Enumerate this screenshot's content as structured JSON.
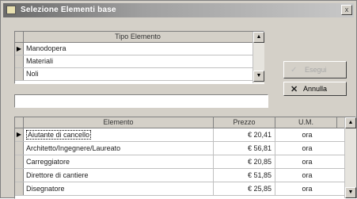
{
  "window": {
    "title": "Selezione Elementi base",
    "close_glyph": "x"
  },
  "types_table": {
    "header": "Tipo Elemento",
    "rows": [
      {
        "label": "Manodopera",
        "current": true
      },
      {
        "label": "Materiali",
        "current": false
      },
      {
        "label": "Noli",
        "current": false
      }
    ],
    "current_marker": "▶",
    "scroll_up": "▲",
    "scroll_down": "▼"
  },
  "buttons": {
    "ok_label": "Esegui",
    "ok_icon": "✓",
    "cancel_label": "Annulla",
    "cancel_icon": "✕"
  },
  "search": {
    "value": ""
  },
  "elements_table": {
    "headers": {
      "name": "Elemento",
      "price": "Prezzo",
      "um": "U.M."
    },
    "rows": [
      {
        "name": "Aiutante di cancello",
        "price": "€ 20,41",
        "um": "ora",
        "current": true
      },
      {
        "name": "Architetto/Ingegnere/Laureato",
        "price": "€ 56,81",
        "um": "ora",
        "current": false
      },
      {
        "name": "Carreggiatore",
        "price": "€ 20,85",
        "um": "ora",
        "current": false
      },
      {
        "name": "Direttore di cantiere",
        "price": "€ 51,85",
        "um": "ora",
        "current": false
      },
      {
        "name": "Disegnatore",
        "price": "€ 25,85",
        "um": "ora",
        "current": false
      }
    ],
    "current_marker": "▶",
    "scroll_up": "▲",
    "scroll_down": "▼"
  }
}
